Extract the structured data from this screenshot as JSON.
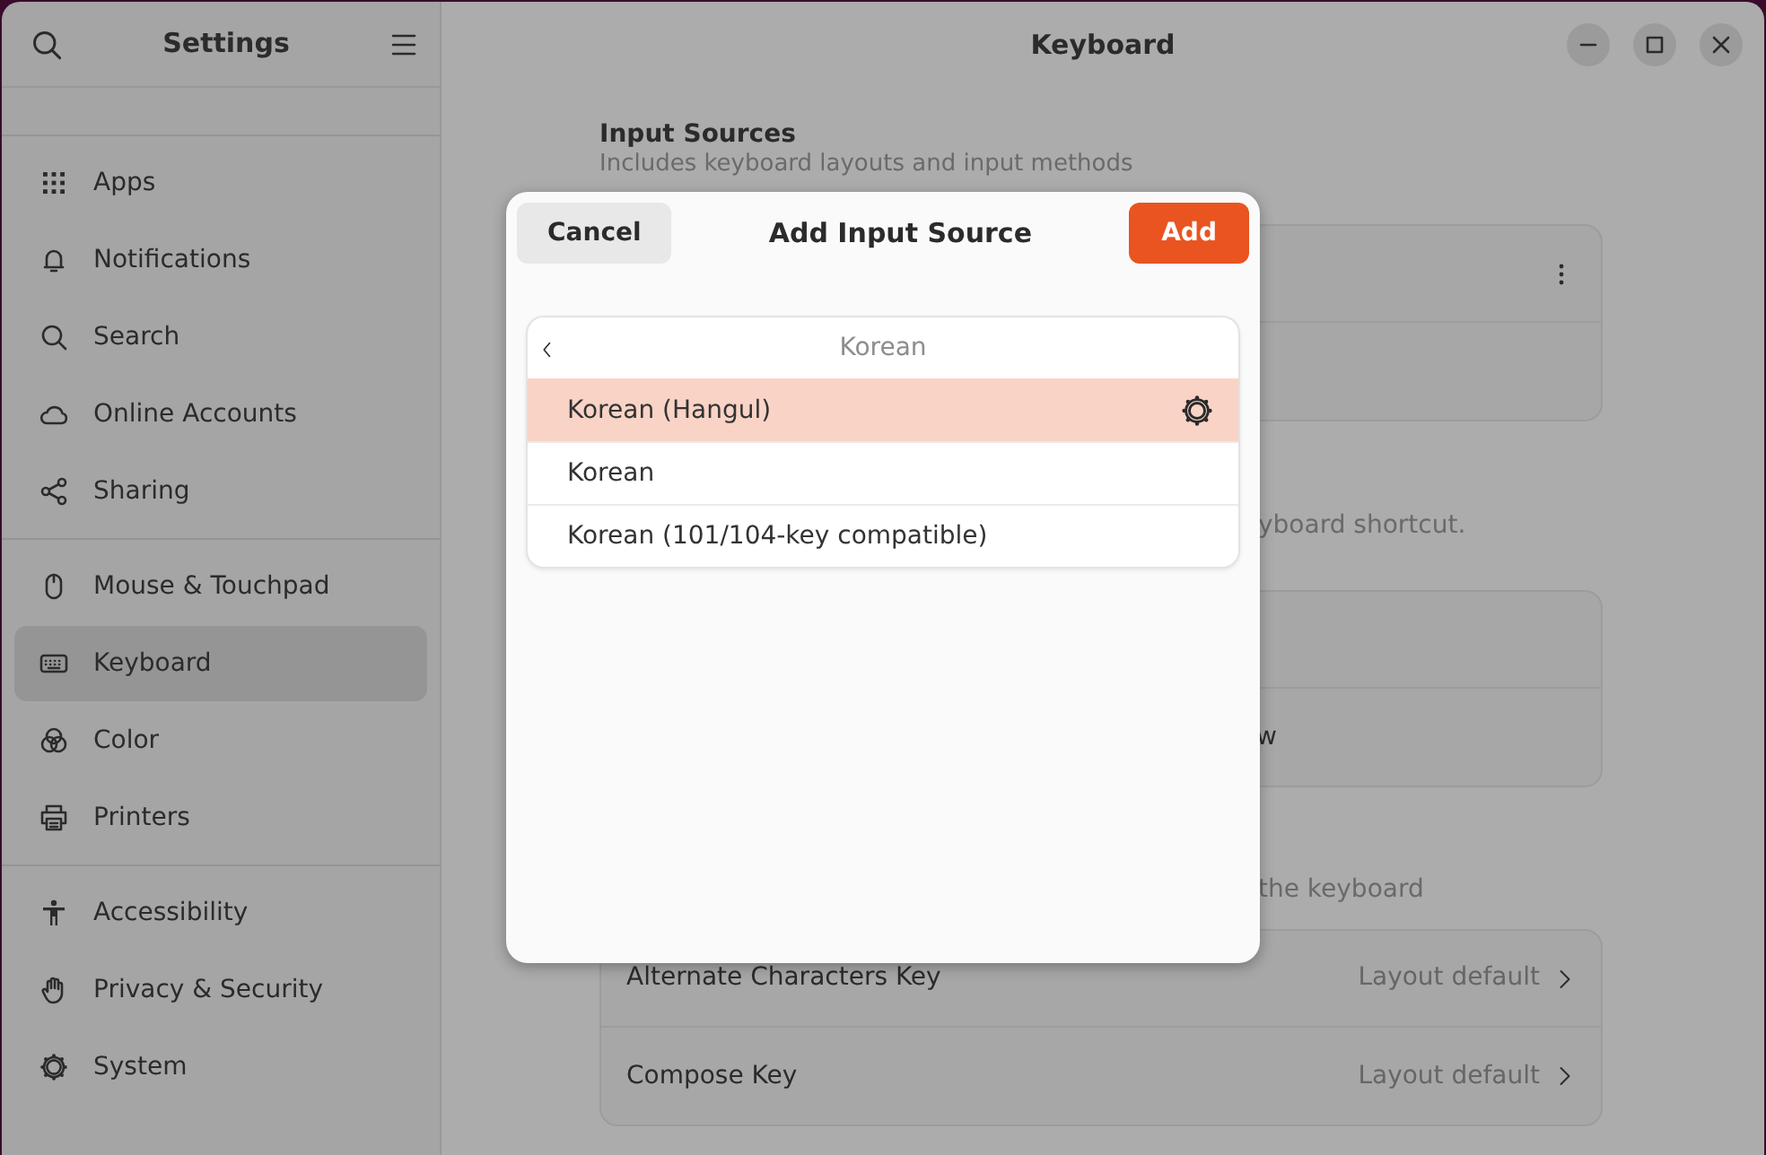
{
  "sidebar": {
    "title": "Settings",
    "groups": [
      {
        "items": [
          {
            "label": "Apps",
            "selected": false
          },
          {
            "label": "Notifications",
            "selected": false
          },
          {
            "label": "Search",
            "selected": false
          },
          {
            "label": "Online Accounts",
            "selected": false
          },
          {
            "label": "Sharing",
            "selected": false
          }
        ]
      },
      {
        "items": [
          {
            "label": "Mouse & Touchpad",
            "selected": false
          },
          {
            "label": "Keyboard",
            "selected": true
          },
          {
            "label": "Color",
            "selected": false
          },
          {
            "label": "Printers",
            "selected": false
          }
        ]
      },
      {
        "items": [
          {
            "label": "Accessibility",
            "selected": false
          },
          {
            "label": "Privacy & Security",
            "selected": false
          },
          {
            "label": "System",
            "selected": false
          }
        ]
      }
    ]
  },
  "page": {
    "title": "Keyboard",
    "sections": [
      {
        "heading": "Input Sources",
        "description": "Includes keyboard layouts and input methods",
        "rows": [
          {
            "kind": "menu"
          },
          {
            "kind": "blank"
          }
        ]
      },
      {
        "description": "yboard shortcut.",
        "rows": [
          {
            "kind": "blank"
          },
          {
            "kind": "text",
            "label": "w"
          }
        ]
      },
      {
        "description": "the keyboard",
        "rows": [
          {
            "kind": "link",
            "label": "Alternate Characters Key",
            "value": "Layout default"
          },
          {
            "kind": "link",
            "label": "Compose Key",
            "value": "Layout default"
          }
        ]
      }
    ]
  },
  "dialog": {
    "title": "Add Input Source",
    "cancel": "Cancel",
    "confirm": "Add",
    "list_title": "Korean",
    "items": [
      {
        "label": "Korean (Hangul)",
        "selected": true,
        "settings": true
      },
      {
        "label": "Korean",
        "selected": false,
        "settings": false
      },
      {
        "label": "Korean (101/104-key compatible)",
        "selected": false,
        "settings": false
      }
    ]
  }
}
